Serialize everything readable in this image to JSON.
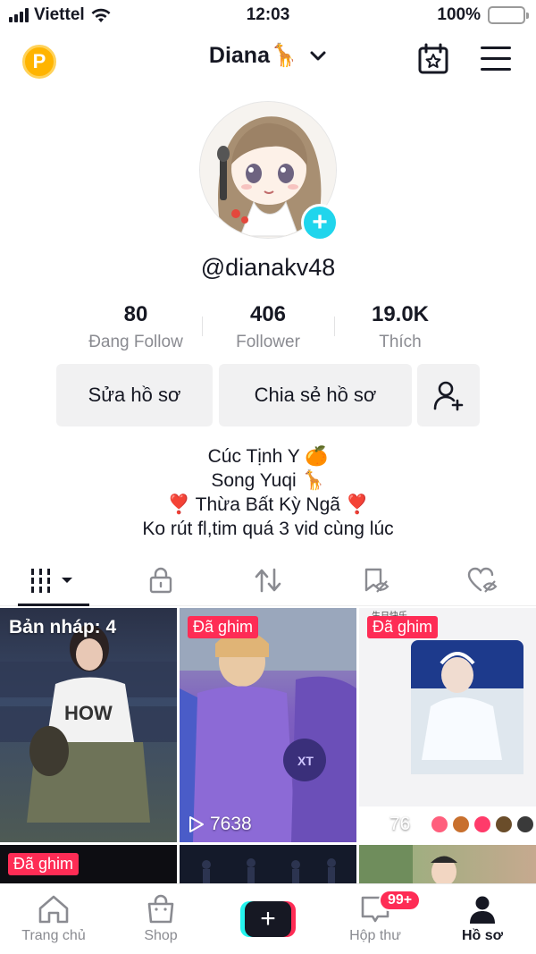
{
  "status_bar": {
    "carrier": "Viettel",
    "time": "12:03",
    "battery": "100%",
    "battery_level": 1.0
  },
  "header": {
    "coin_label": "P",
    "username": "Diana🦒",
    "icons": [
      "coin-icon",
      "chevron-down-icon",
      "calendar-star-icon",
      "menu-icon"
    ]
  },
  "profile": {
    "handle": "@dianakv48",
    "avatar_action": "+"
  },
  "stats": [
    {
      "value": "80",
      "label": "Đang Follow"
    },
    {
      "value": "406",
      "label": "Follower"
    },
    {
      "value": "19.0K",
      "label": "Thích"
    }
  ],
  "buttons": {
    "edit": "Sửa hồ sơ",
    "share": "Chia sẻ hồ sơ",
    "add_friend_icon": "add-user-icon"
  },
  "bio": [
    "Cúc Tịnh Y 🍊",
    "Song Yuqi 🦒",
    "❣️ Thừa Bất Kỳ Ngã ❣️",
    "Ko rút fl,tim quá 3 vid cùng lúc"
  ],
  "tabs": [
    {
      "icon": "grid-icon",
      "active": true
    },
    {
      "icon": "lock-icon"
    },
    {
      "icon": "repost-icon"
    },
    {
      "icon": "hidden-bookmark-icon"
    },
    {
      "icon": "hidden-heart-icon"
    }
  ],
  "videos": [
    {
      "draft_label": "Bản nháp: 4"
    },
    {
      "pinned": "Đã ghim",
      "views": "7638"
    },
    {
      "pinned": "Đã ghim",
      "views": "76",
      "caption": "生日快乐"
    },
    {
      "pinned": "Đã ghim"
    },
    {},
    {}
  ],
  "nav": {
    "home": "Trang chủ",
    "shop": "Shop",
    "create": "+",
    "inbox": "Hộp thư",
    "inbox_badge": "99+",
    "profile": "Hồ sơ"
  },
  "colors": {
    "accent_red": "#fe2c55",
    "accent_cyan": "#25f4ee",
    "avatar_plus": "#20d5ec",
    "coin": "#ffb400",
    "battery": "#f5c400"
  }
}
